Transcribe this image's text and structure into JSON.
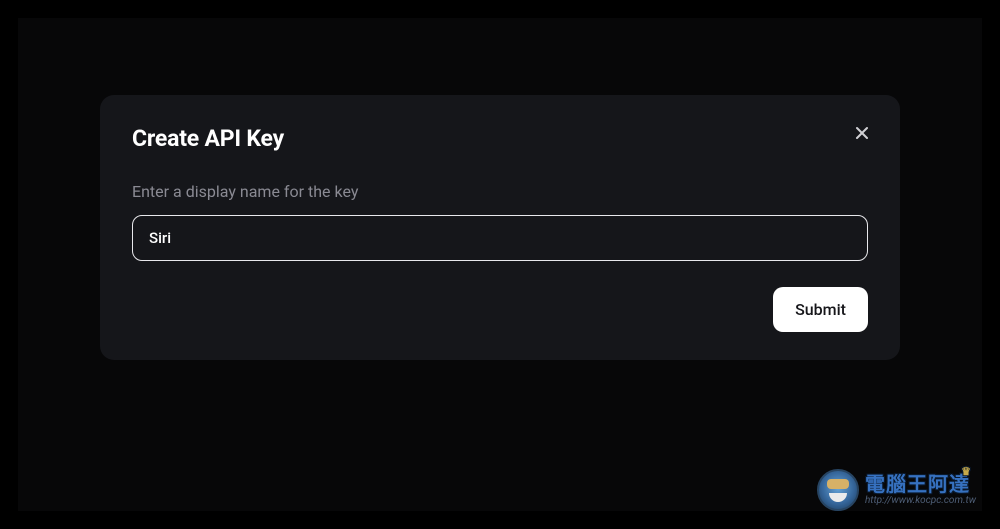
{
  "modal": {
    "title": "Create API Key",
    "field_label": "Enter a display name for the key",
    "input_value": "Siri",
    "submit_label": "Submit"
  },
  "watermark": {
    "text": "電腦王阿達",
    "url": "http://www.kocpc.com.tw"
  }
}
